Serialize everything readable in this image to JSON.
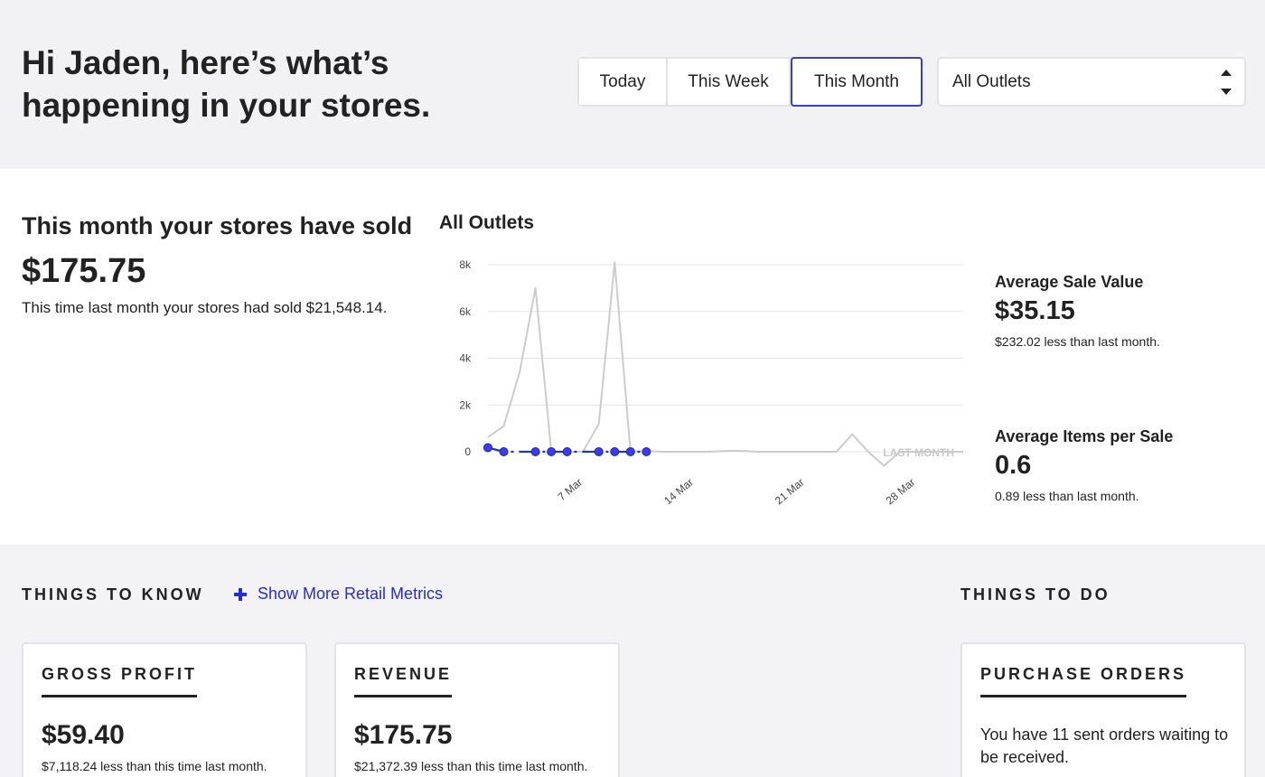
{
  "greeting": "Hi Jaden, here’s what’s happening in your stores.",
  "period_tabs": [
    {
      "label": "Today",
      "active": false
    },
    {
      "label": "This Week",
      "active": false
    },
    {
      "label": "This Month",
      "active": true
    }
  ],
  "outlet_select": {
    "value": "All Outlets"
  },
  "summary": {
    "heading": "This month your stores have sold",
    "amount": "$175.75",
    "comparison": "This time last month your stores had sold $21,548.14."
  },
  "chart_data": {
    "type": "line",
    "title": "All Outlets",
    "x_tick_labels": [
      "7 Mar",
      "14 Mar",
      "21 Mar",
      "28 Mar"
    ],
    "y_tick_labels": [
      "0",
      "2k",
      "4k",
      "6k",
      "8k"
    ],
    "ylim": [
      0,
      8000
    ],
    "xlim": [
      1,
      31
    ],
    "grid": true,
    "series": [
      {
        "name": "LAST MONTH",
        "color": "#cccccc",
        "x": [
          1,
          2,
          3,
          4,
          5,
          6,
          7,
          8,
          9,
          10,
          11,
          12,
          13,
          14,
          15,
          16,
          17,
          18,
          19,
          20,
          21,
          22,
          23,
          24,
          25,
          26,
          27,
          28,
          29,
          30,
          31
        ],
        "y": [
          620,
          1100,
          3400,
          7000,
          0,
          0,
          0,
          1200,
          8100,
          0,
          40,
          0,
          0,
          0,
          0,
          40,
          40,
          0,
          0,
          0,
          0,
          0,
          0,
          750,
          0,
          -600,
          0,
          0,
          0,
          0,
          0
        ]
      },
      {
        "name": "",
        "color": "#1f3b9c",
        "marker_color": "#3b3bf0",
        "x": [
          1,
          2,
          3,
          4,
          5,
          6,
          7,
          8,
          9,
          10,
          11
        ],
        "y": [
          175,
          0,
          0,
          0,
          0,
          0,
          0,
          0,
          0,
          0,
          0
        ],
        "markers_at": [
          1,
          2,
          4,
          5,
          6,
          8,
          9,
          10,
          11
        ]
      }
    ]
  },
  "metrics": {
    "avg_sale_label": "Average Sale Value",
    "avg_sale_value": "$35.15",
    "avg_sale_note": "$232.02 less than last month.",
    "avg_items_label": "Average Items per Sale",
    "avg_items_value": "0.6",
    "avg_items_note": "0.89 less than last month."
  },
  "things_to_know": {
    "heading": "THINGS TO KNOW",
    "show_more": "Show More Retail Metrics",
    "cards": [
      {
        "title": "GROSS PROFIT",
        "value": "$59.40",
        "note": "$7,118.24 less than this time last month."
      },
      {
        "title": "REVENUE",
        "value": "$175.75",
        "note": "$21,372.39 less than this time last month."
      }
    ]
  },
  "things_to_do": {
    "heading": "THINGS TO DO",
    "cards": [
      {
        "title": "PURCHASE ORDERS",
        "text": "You have 11 sent orders waiting to be received."
      }
    ]
  }
}
